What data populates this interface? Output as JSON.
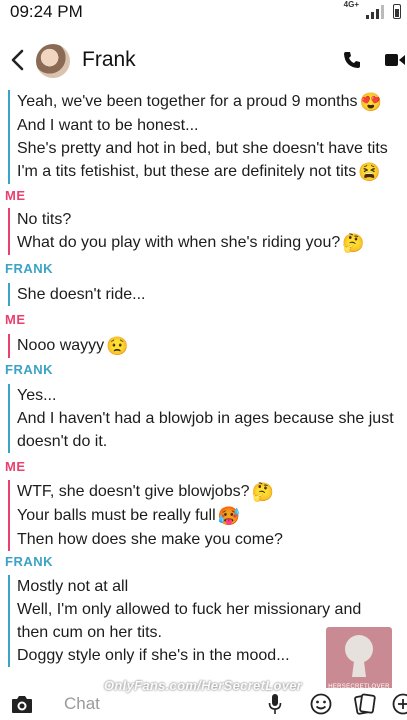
{
  "status": {
    "time": "09:24 PM",
    "network": "4G+"
  },
  "header": {
    "contact_name": "Frank",
    "back_icon": "chevron-left-icon",
    "call_icon": "phone-icon",
    "video_icon": "video-camera-icon"
  },
  "chat": {
    "block1": {
      "lines": [
        "Yeah, we've been together for a proud 9 months",
        "And I want to be honest...",
        "She's pretty and hot in bed, but she doesn't have tits",
        "I'm a tits fetishist, but these are definitely not tits"
      ]
    },
    "label_me_1": "ME",
    "block2": {
      "lines": [
        "No tits?",
        "What do you play with when she's riding you?"
      ]
    },
    "label_frank_1": "FRANK",
    "block3": {
      "lines": [
        "She doesn't ride..."
      ]
    },
    "label_me_2": "ME",
    "block4": {
      "lines": [
        "Nooo wayyy"
      ]
    },
    "label_frank_2": "FRANK",
    "block5": {
      "lines": [
        "Yes...",
        "And I haven't had a blowjob in ages because she just",
        "doesn't do it."
      ]
    },
    "label_me_3": "ME",
    "block6": {
      "lines": [
        "WTF, she doesn't give blowjobs?",
        "Your balls must be really full",
        "Then how does she make you come?"
      ]
    },
    "label_frank_3": "FRANK",
    "block7": {
      "lines": [
        "Mostly not at all",
        "Well, I'm only allowed to fuck her missionary and",
        "then cum on her tits.",
        "Doggy style only if she's in the mood..."
      ]
    }
  },
  "watermark": {
    "text": "OnlyFans.com/HerSecretLover",
    "logo_text": "HERSECRETLOVER"
  },
  "bottom": {
    "placeholder": "Chat"
  },
  "colors": {
    "me": "#e8416f",
    "frank": "#3aa3c6"
  }
}
